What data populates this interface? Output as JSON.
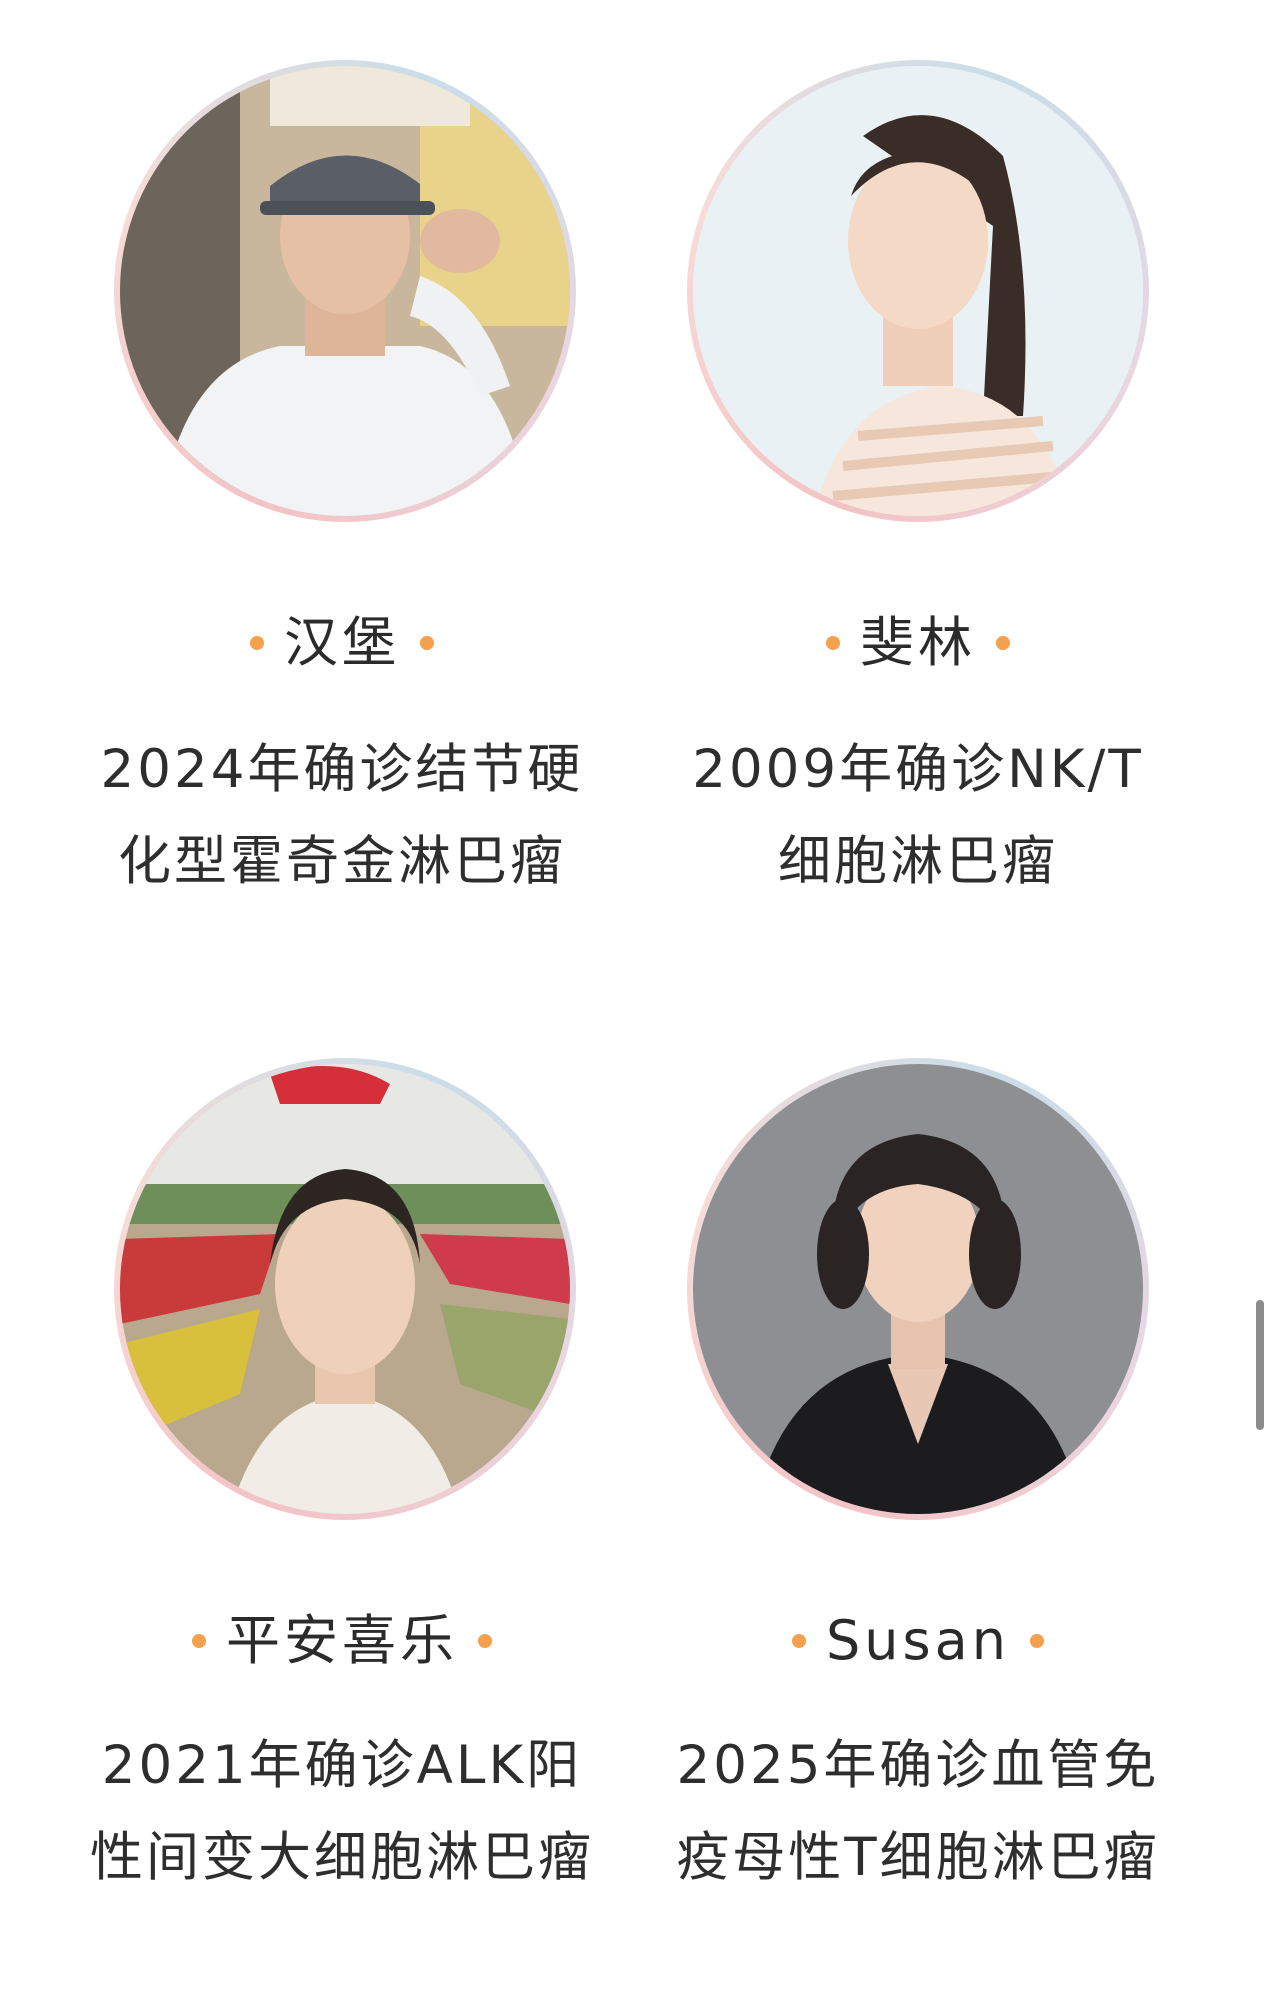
{
  "profiles": [
    {
      "name": "汉堡",
      "desc_line1": "2024年确诊结节硬",
      "desc_line2": "化型霍奇金淋巴瘤"
    },
    {
      "name": "斐林",
      "desc_line1": "2009年确诊NK/T",
      "desc_line2": "细胞淋巴瘤"
    },
    {
      "name": "平安喜乐",
      "desc_line1": "2021年确诊ALK阳",
      "desc_line2": "性间变大细胞淋巴瘤"
    },
    {
      "name": "Susan",
      "desc_line1": "2025年确诊血管免",
      "desc_line2": "疫母性T细胞淋巴瘤"
    }
  ],
  "colors": {
    "accent_dot": "#f4a04c",
    "ring_pink": "#f3c3c5",
    "ring_blue": "#c9dde8"
  },
  "icons": [
    "bullet-dot-icon"
  ]
}
